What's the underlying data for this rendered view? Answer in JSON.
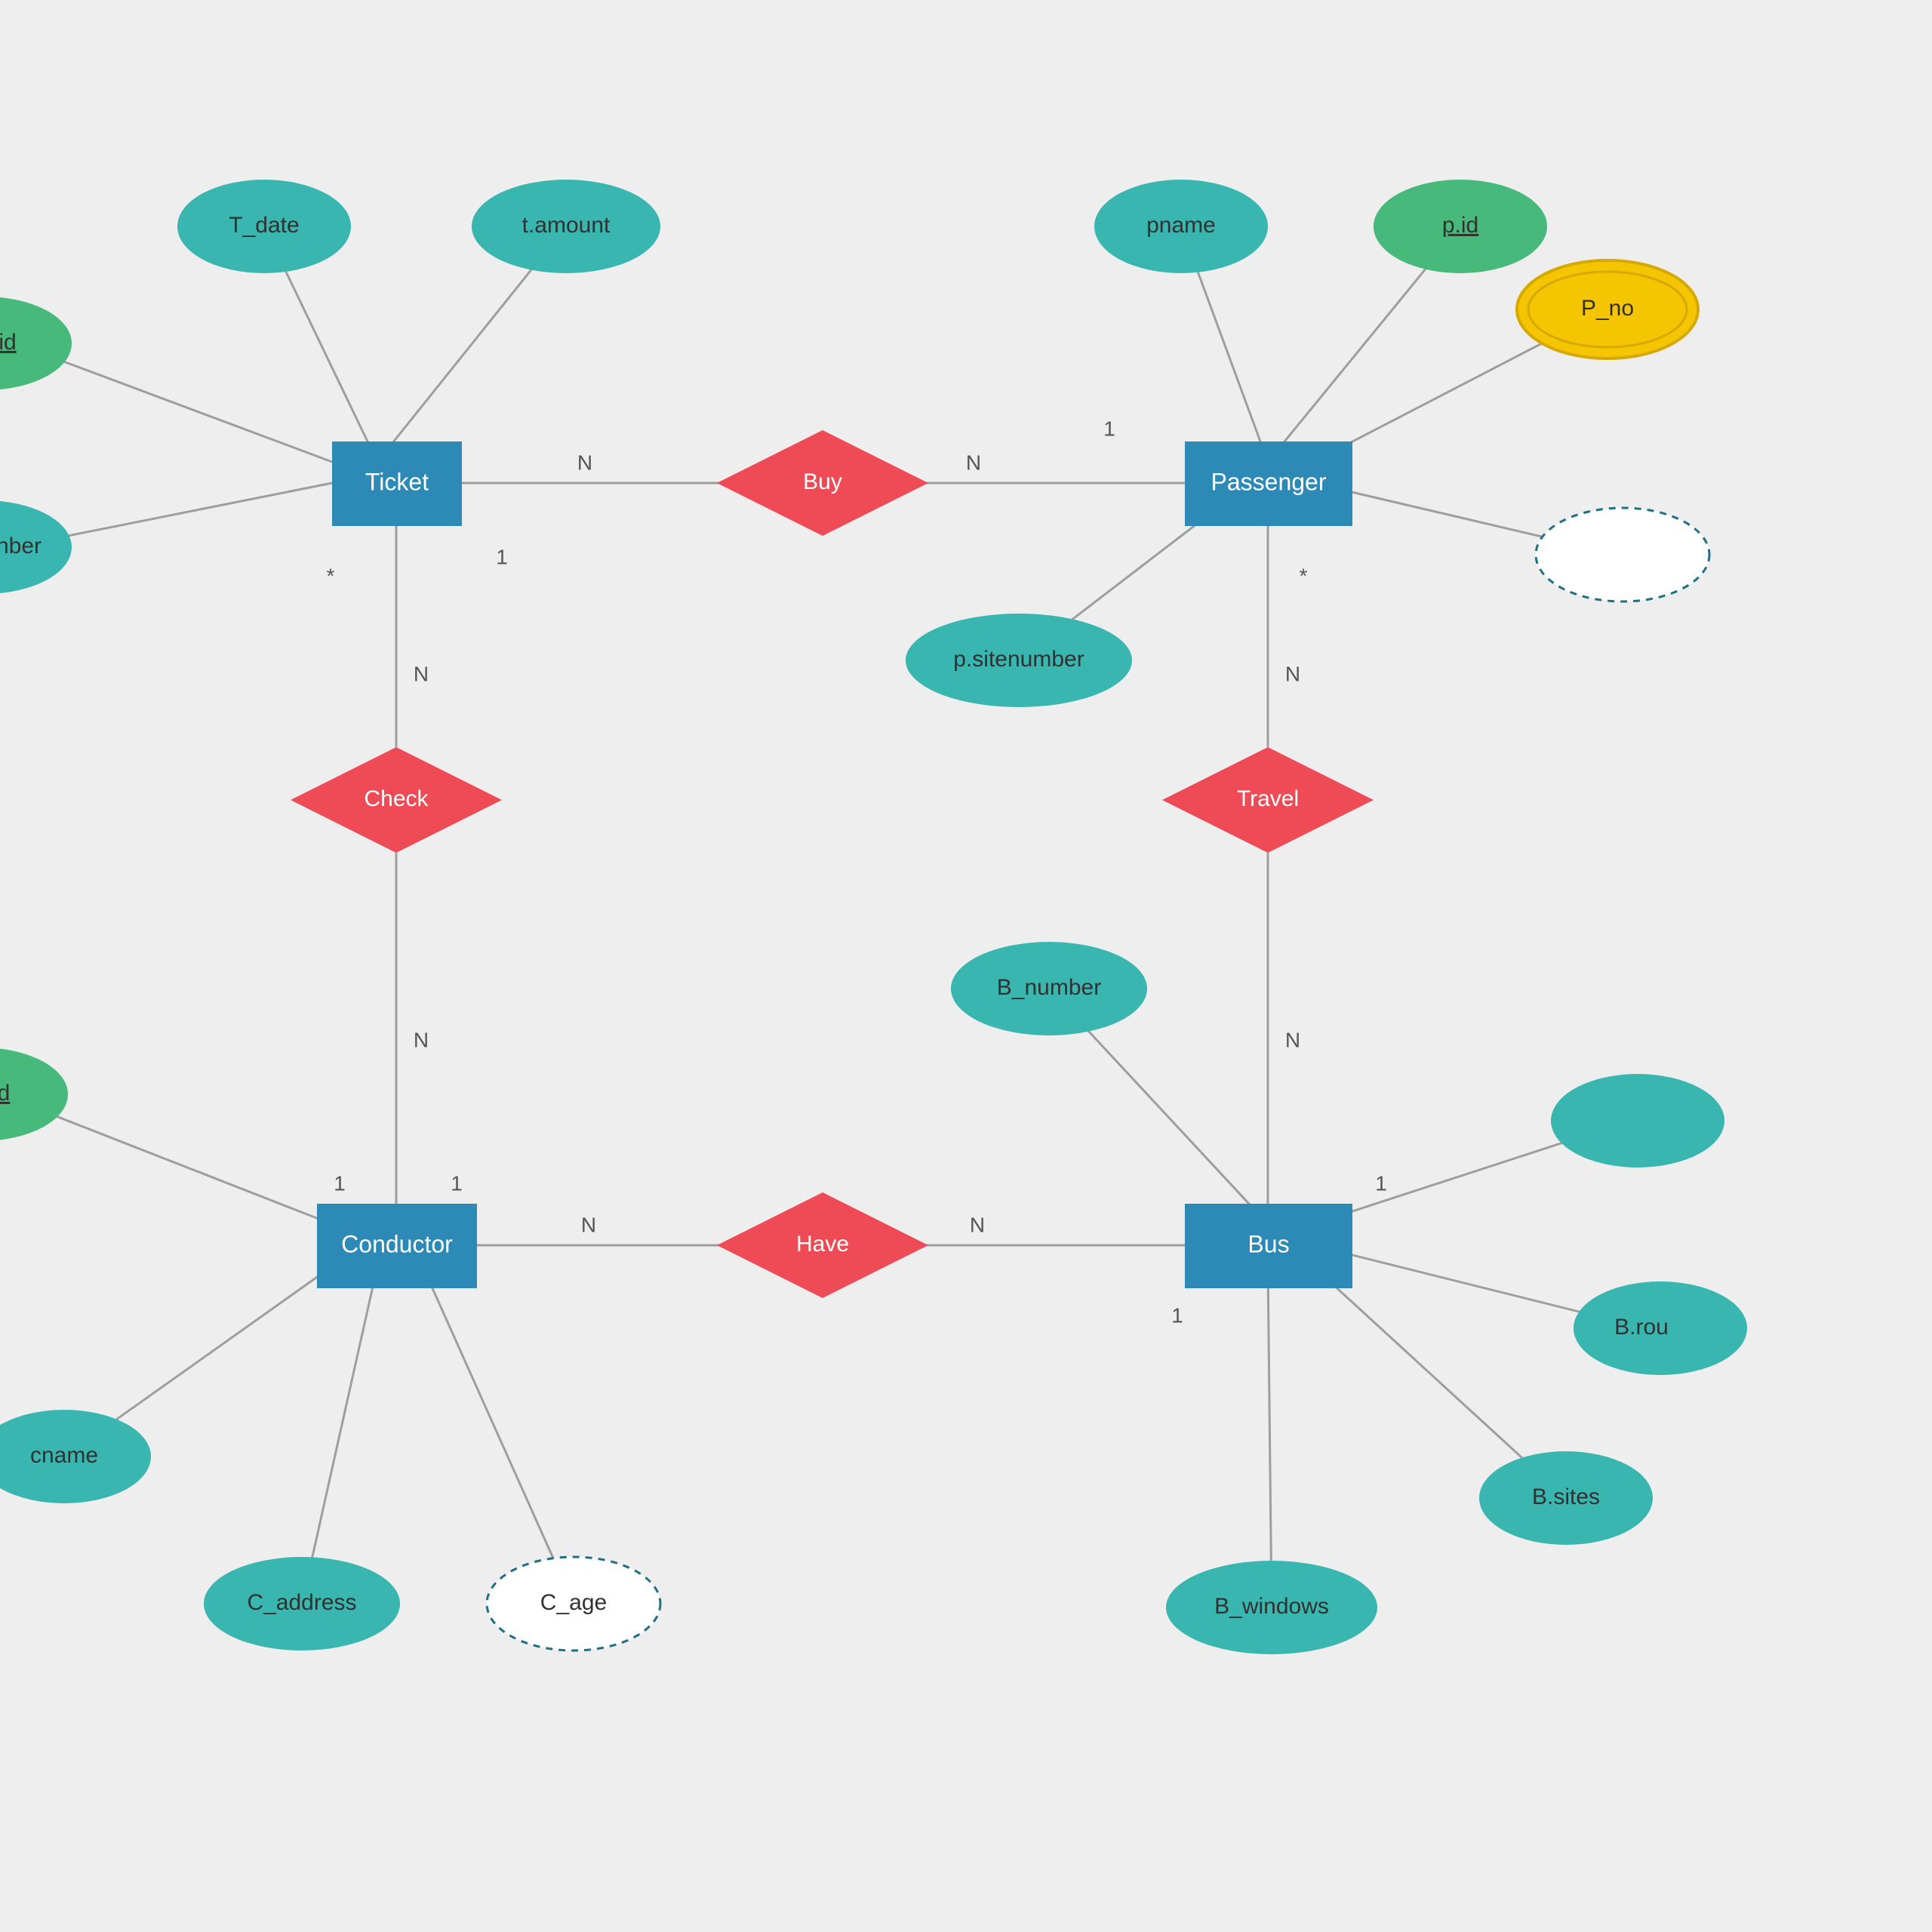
{
  "diagram": {
    "type": "ER",
    "entities": {
      "ticket": {
        "label": "Ticket"
      },
      "passenger": {
        "label": "Passenger"
      },
      "conductor": {
        "label": "Conductor"
      },
      "bus": {
        "label": "Bus"
      }
    },
    "relationships": {
      "buy": {
        "label": "Buy"
      },
      "check": {
        "label": "Check"
      },
      "have": {
        "label": "Have"
      },
      "travel": {
        "label": "Travel"
      }
    },
    "attributes": {
      "t_id": {
        "label": "id",
        "key": true
      },
      "t_date": {
        "label": "T_date"
      },
      "t_amount": {
        "label": "t.amount"
      },
      "t_nber": {
        "label": "nber"
      },
      "p_pname": {
        "label": "pname"
      },
      "p_id": {
        "label": "p.id",
        "key": true
      },
      "p_no": {
        "label": "P_no",
        "multivalued": true
      },
      "p_site": {
        "label": "p.sitenumber"
      },
      "p_derived": {
        "label": "",
        "derived": true
      },
      "c_id": {
        "label": "d",
        "key": true
      },
      "c_name": {
        "label": "cname"
      },
      "c_address": {
        "label": "C_address"
      },
      "c_age": {
        "label": "C_age",
        "derived": true
      },
      "b_number": {
        "label": "B_number"
      },
      "b_attr1": {
        "label": ""
      },
      "b_route": {
        "label": "B.rou"
      },
      "b_sites": {
        "label": "B.sites"
      },
      "b_windows": {
        "label": "B_windows"
      }
    },
    "cardinalities": {
      "ticket_buy": "N",
      "buy_passenger_l": "N",
      "buy_passenger_r": "1",
      "ticket_check_top": "1",
      "ticket_check_n": "N",
      "check_conductor": "N",
      "conductor_ul": "1",
      "conductor_ur": "1",
      "conductor_have": "N",
      "have_bus": "N",
      "bus_ur": "1",
      "bus_br": "1",
      "passenger_travel": "N",
      "travel_bus": "N",
      "ticket_star": "*",
      "passenger_star": "*"
    }
  },
  "colors": {
    "entity": "#2D8AB6",
    "relation": "#EE4B56",
    "attr": "#39B6B0",
    "attrKey": "#47B97B",
    "attrMulti": "#F4C500",
    "attrMultiStroke": "#D5A900",
    "derivedStroke": "#1F6F87",
    "edge": "#9E9E9E",
    "bg": "#EEEEEE"
  }
}
